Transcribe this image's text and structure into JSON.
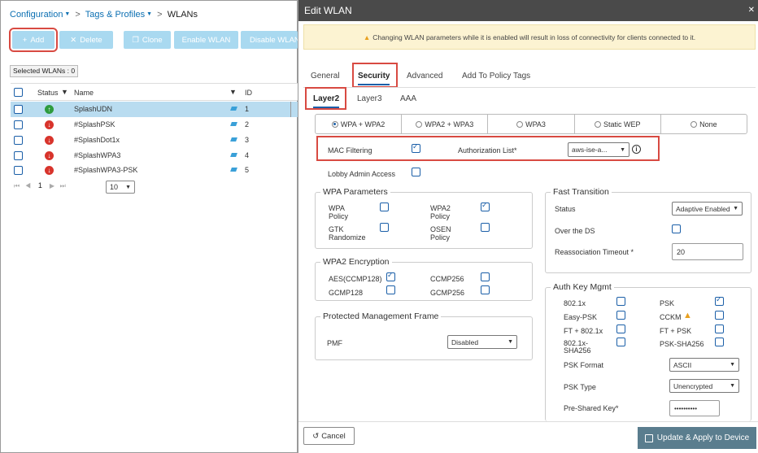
{
  "breadcrumb": {
    "configuration": "Configuration",
    "tags_profiles": "Tags & Profiles",
    "current": "WLANs"
  },
  "toolbar": {
    "add": "Add",
    "delete": "Delete",
    "clone": "Clone",
    "enable": "Enable WLAN",
    "disable": "Disable WLAN"
  },
  "selected_count": "Selected WLANs : 0",
  "table": {
    "columns": [
      "Status",
      "Name",
      "ID"
    ],
    "rows": [
      {
        "status": "up",
        "name": "SplashUDN",
        "id": "1"
      },
      {
        "status": "down",
        "name": "#SplashPSK",
        "id": "2"
      },
      {
        "status": "down",
        "name": "#SplashDot1x",
        "id": "3"
      },
      {
        "status": "down",
        "name": "#SplashWPA3",
        "id": "4"
      },
      {
        "status": "down",
        "name": "#SplashWPA3-PSK",
        "id": "5"
      }
    ],
    "page": "1",
    "page_size": "10"
  },
  "dialog": {
    "title": "Edit WLAN",
    "warning": "Changing WLAN parameters while it is enabled will result in loss of connectivity for clients connected to it.",
    "tabs": [
      "General",
      "Security",
      "Advanced",
      "Add To Policy Tags"
    ],
    "subtabs": [
      "Layer2",
      "Layer3",
      "AAA"
    ],
    "security_modes": [
      {
        "label": "WPA + WPA2",
        "selected": true
      },
      {
        "label": "WPA2 + WPA3",
        "selected": false
      },
      {
        "label": "WPA3",
        "selected": false
      },
      {
        "label": "Static WEP",
        "selected": false
      },
      {
        "label": "None",
        "selected": false
      }
    ],
    "mac_filtering": {
      "label": "MAC Filtering",
      "checked": true
    },
    "authorization_list": {
      "label": "Authorization List*",
      "value": "aws-ise-a..."
    },
    "lobby_admin": {
      "label": "Lobby Admin Access",
      "checked": false
    },
    "wpa_params": {
      "title": "WPA Parameters",
      "wpa_policy": "WPA\nPolicy",
      "wpa2_policy": "WPA2\nPolicy",
      "gtk_randomize": "GTK\nRandomize",
      "osen_policy": "OSEN\nPolicy"
    },
    "wpa2_encryption": {
      "title": "WPA2 Encryption",
      "aes": "AES(CCMP128)",
      "ccmp256": "CCMP256",
      "gcmp128": "GCMP128",
      "gcmp256": "GCMP256"
    },
    "pmf": {
      "title": "Protected Management Frame",
      "label": "PMF",
      "value": "Disabled"
    },
    "fast_transition": {
      "title": "Fast Transition",
      "status_label": "Status",
      "status_value": "Adaptive Enabled",
      "over_ds": "Over the DS",
      "reassoc_label": "Reassociation Timeout *",
      "reassoc_value": "20"
    },
    "akm": {
      "title": "Auth Key Mgmt",
      "dot1x": "802.1x",
      "psk": "PSK",
      "easy_psk": "Easy-PSK",
      "cckm": "CCKM",
      "ft_dot1x": "FT + 802.1x",
      "ft_psk": "FT + PSK",
      "dot1x_sha256": "802.1x-\nSHA256",
      "psk_sha256": "PSK-SHA256",
      "psk_format_label": "PSK Format",
      "psk_format_value": "ASCII",
      "psk_type_label": "PSK Type",
      "psk_type_value": "Unencrypted",
      "pre_shared_label": "Pre-Shared Key*",
      "pre_shared_value": "••••••••••"
    },
    "cancel": "Cancel",
    "update": "Update & Apply to Device"
  },
  "colors": {
    "accent": "#1b5fa8",
    "highlight": "#d84a42",
    "status_up": "#2e9b3e",
    "status_down": "#d8342c"
  }
}
